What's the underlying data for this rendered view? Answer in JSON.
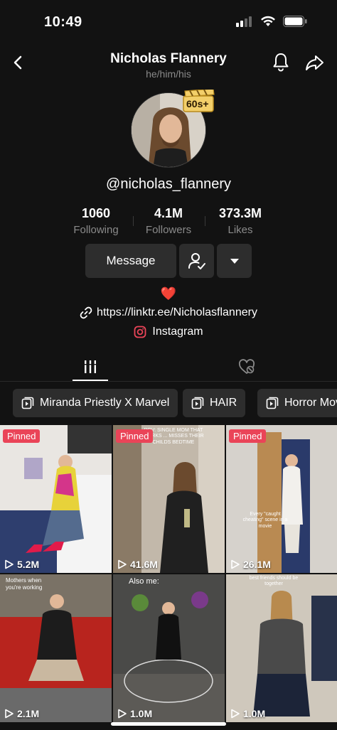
{
  "status_bar": {
    "time": "10:49"
  },
  "header": {
    "title": "Nicholas Flannery",
    "pronouns": "he/him/his"
  },
  "profile": {
    "badge": "60s+",
    "username": "@nicholas_flannery"
  },
  "stats": [
    {
      "value": "1060",
      "label": "Following"
    },
    {
      "value": "4.1M",
      "label": "Followers"
    },
    {
      "value": "373.3M",
      "label": "Likes"
    }
  ],
  "actions": {
    "message_label": "Message"
  },
  "bio": {
    "heart": "❤️",
    "link": "https://linktr.ee/Nicholasflannery",
    "instagram": "Instagram"
  },
  "playlists": [
    "Miranda Priestly X Marvel",
    "HAIR",
    "Horror Movie"
  ],
  "videos": [
    {
      "pinned": "Pinned",
      "views": "5.2M",
      "overlay": ""
    },
    {
      "pinned": "Pinned",
      "views": "41.6M",
      "overlay": "POV: SINGLE MOM THAT WORKS ... MISSES THEIR CHILDS BEDTIME"
    },
    {
      "pinned": "Pinned",
      "views": "26.1M",
      "overlay": "Every \"caught cheating\" scene in a movie"
    },
    {
      "pinned": "",
      "views": "2.1M",
      "overlay": "Mothers when you're working"
    },
    {
      "pinned": "",
      "views": "1.0M",
      "overlay": "Also me:"
    },
    {
      "pinned": "",
      "views": "1.0M",
      "overlay": "best friends should be together"
    }
  ],
  "colors": {
    "background": "#121212",
    "button": "#2d2d2d",
    "pinned": "#ea4458",
    "muted": "#8a8a8a"
  }
}
